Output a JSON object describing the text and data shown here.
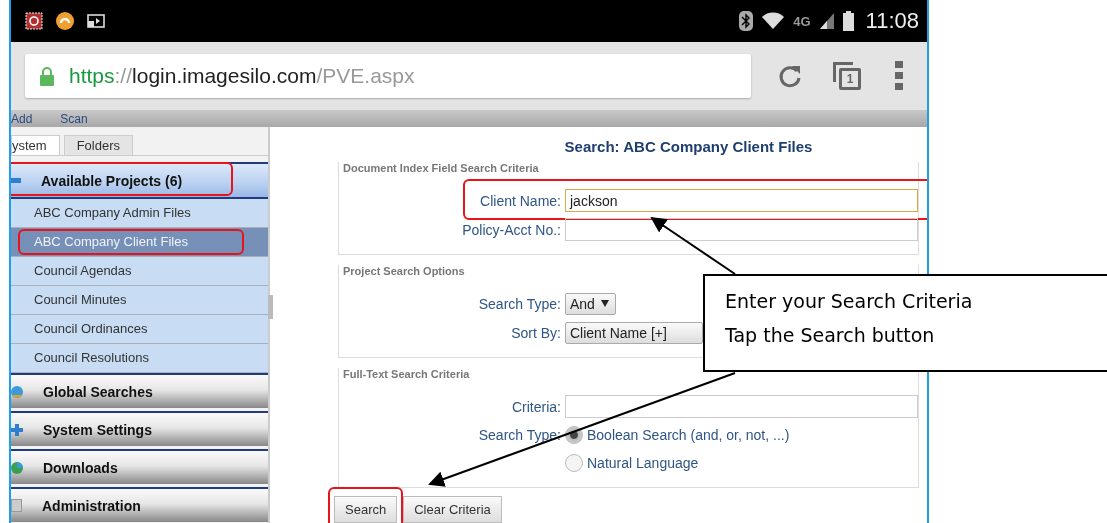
{
  "status_bar": {
    "network": "4G",
    "time": "11:08"
  },
  "browser": {
    "secure": true,
    "url": {
      "scheme": "https",
      "separator": "://",
      "host": "login.imagesilo.com",
      "path": "/PVE.aspx"
    },
    "tab_count": "1"
  },
  "toolbar": [
    "Add",
    "Scan"
  ],
  "sidebar": {
    "tabs": [
      {
        "label": "ystem",
        "selected": true
      },
      {
        "label": "Folders",
        "selected": false
      }
    ],
    "sections": [
      {
        "label": "Available Projects (6)",
        "expanded": true,
        "highlighted": true,
        "items": [
          {
            "label": "ABC Company Admin Files",
            "selected": false,
            "highlighted": false
          },
          {
            "label": "ABC Company Client Files",
            "selected": true,
            "highlighted": true
          },
          {
            "label": "Council Agendas",
            "selected": false,
            "highlighted": false
          },
          {
            "label": "Council Minutes",
            "selected": false,
            "highlighted": false
          },
          {
            "label": "Council Ordinances",
            "selected": false,
            "highlighted": false
          },
          {
            "label": "Council Resolutions",
            "selected": false,
            "highlighted": false
          }
        ]
      },
      {
        "label": "Global Searches",
        "expanded": false,
        "highlighted": false
      },
      {
        "label": "System Settings",
        "expanded": false,
        "highlighted": false
      },
      {
        "label": "Downloads",
        "expanded": false,
        "highlighted": false
      },
      {
        "label": "Administration",
        "expanded": false,
        "highlighted": false
      }
    ]
  },
  "search": {
    "title": "Search: ABC Company Client Files",
    "groups": [
      {
        "legend": "Document Index Field Search Criteria",
        "rows": [
          {
            "kind": "text",
            "label": "Client Name:",
            "value": "jackson",
            "focused": true,
            "highlighted": true
          },
          {
            "kind": "text",
            "label": "Policy-Acct No.:",
            "focused": false,
            "highlighted": false
          }
        ]
      },
      {
        "legend": "Project Search Options",
        "rows": [
          {
            "kind": "select",
            "label": "Search Type:",
            "value": "And",
            "highlighted": false
          },
          {
            "kind": "long-select",
            "label": "Sort By:",
            "value": "Client Name [+]",
            "highlighted": false
          }
        ]
      },
      {
        "legend": "Full-Text Search Criteria",
        "rows": [
          {
            "kind": "text",
            "label": "Criteria:",
            "focused": false,
            "highlighted": false
          },
          {
            "kind": "radio",
            "label": "Search Type:",
            "highlighted": false,
            "options": [
              {
                "label": "Boolean Search (and, or, not, ...)",
                "selected": true
              },
              {
                "label": "Natural Language",
                "selected": false
              }
            ]
          }
        ]
      }
    ],
    "buttons": [
      {
        "label": "Search",
        "highlighted": true
      },
      {
        "label": "Clear Criteria",
        "highlighted": false
      }
    ]
  },
  "callout": {
    "lines": [
      "Enter your Search Criteria",
      "Tap the Search button"
    ]
  }
}
